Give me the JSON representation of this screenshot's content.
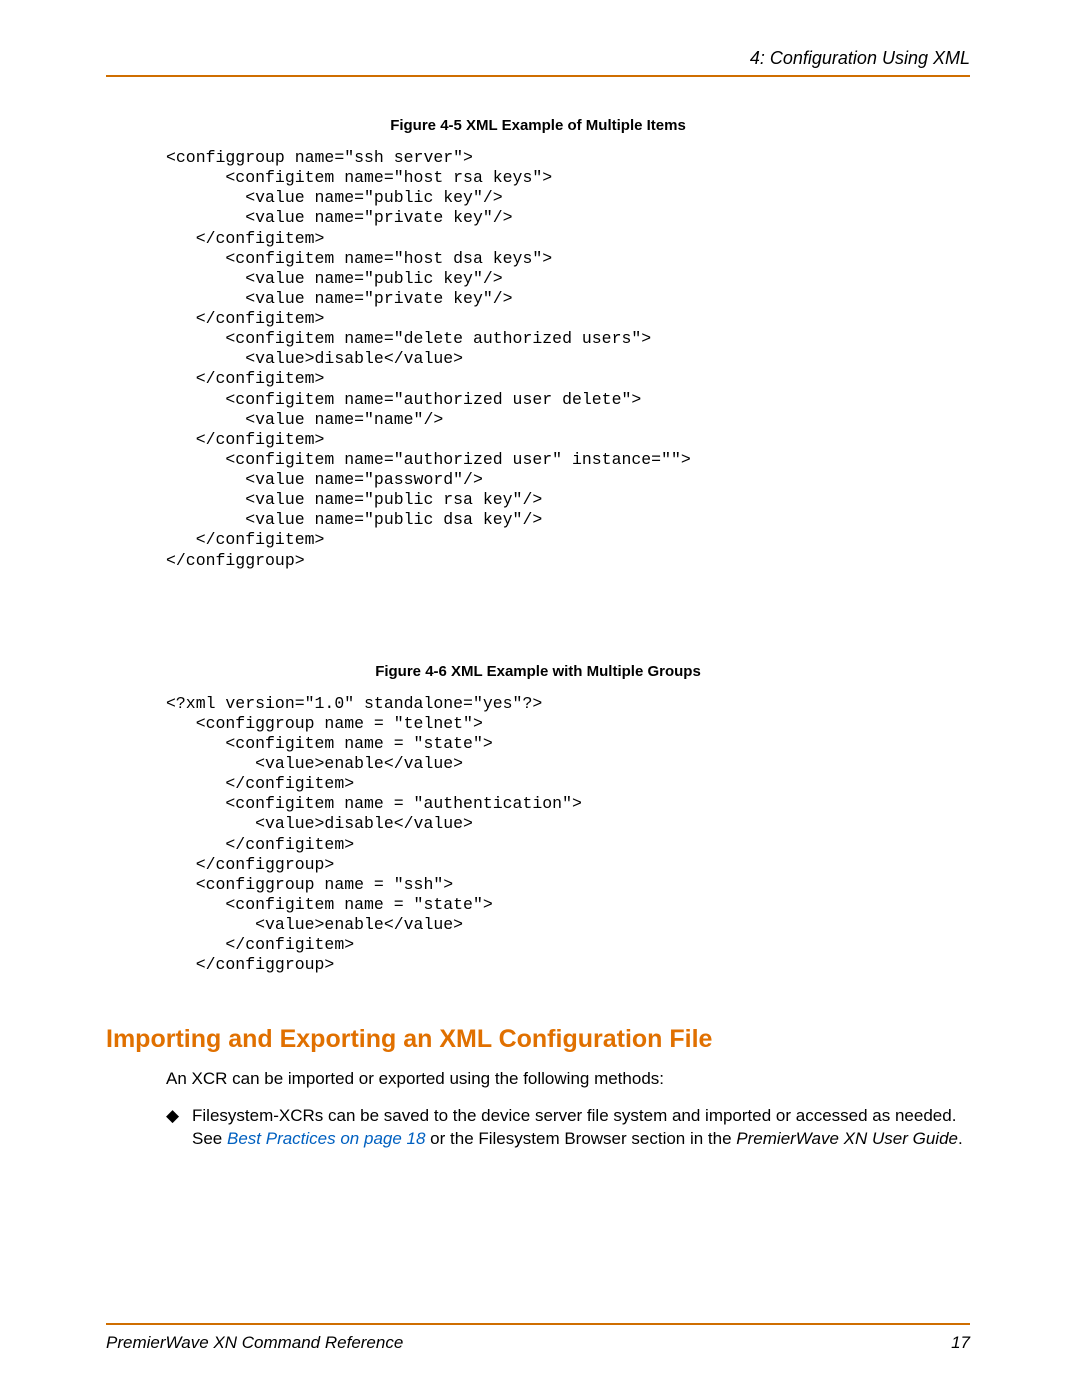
{
  "header": {
    "chapter_title": "4: Configuration Using XML"
  },
  "figures": {
    "fig5_caption": "Figure 4-5  XML Example of Multiple Items",
    "fig5_code": "<configgroup name=\"ssh server\">\n      <configitem name=\"host rsa keys\">\n        <value name=\"public key\"/>\n        <value name=\"private key\"/>\n   </configitem>\n      <configitem name=\"host dsa keys\">\n        <value name=\"public key\"/>\n        <value name=\"private key\"/>\n   </configitem>\n      <configitem name=\"delete authorized users\">\n        <value>disable</value>\n   </configitem>\n      <configitem name=\"authorized user delete\">\n        <value name=\"name\"/>\n   </configitem>\n      <configitem name=\"authorized user\" instance=\"\">\n        <value name=\"password\"/>\n        <value name=\"public rsa key\"/>\n        <value name=\"public dsa key\"/>\n   </configitem>\n</configgroup>",
    "fig6_caption": "Figure 4-6  XML Example with Multiple Groups",
    "fig6_code": "<?xml version=\"1.0\" standalone=\"yes\"?>\n   <configgroup name = \"telnet\">\n      <configitem name = \"state\">\n         <value>enable</value>\n      </configitem>\n      <configitem name = \"authentication\">\n         <value>disable</value>\n      </configitem>\n   </configgroup>\n   <configgroup name = \"ssh\">\n      <configitem name = \"state\">\n         <value>enable</value>\n      </configitem>\n   </configgroup>"
  },
  "section": {
    "heading": "Importing and Exporting an XML Configuration File",
    "intro": "An XCR can be imported or exported using the following methods:",
    "bullet_glyph": "◆",
    "bullet_prefix": "Filesystem-XCRs can be saved to the device server file system and imported or accessed as needed. See ",
    "bullet_link": "Best Practices on page 18",
    "bullet_middle": " or the Filesystem Browser section in the ",
    "bullet_book": "PremierWave XN User Guide",
    "bullet_suffix": "."
  },
  "footer": {
    "left": "PremierWave XN Command Reference",
    "right": "17"
  }
}
